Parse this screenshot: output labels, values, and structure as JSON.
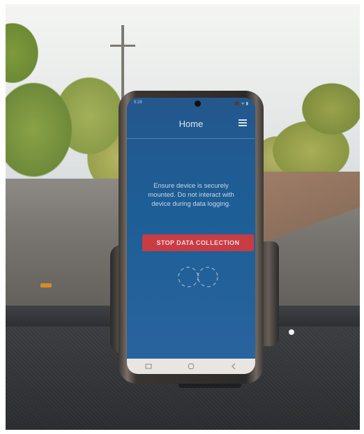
{
  "app": {
    "title": "Home",
    "status_time": "5:28",
    "status_right": "⬛ ᯤ ▮"
  },
  "screen": {
    "instructions": "Ensure device is securely mounted. Do not interact with device during data logging.",
    "stop_button_label": "STOP DATA COLLECTION"
  },
  "colors": {
    "screen_blue": "#1d5e96",
    "button_red": "#c83c44"
  },
  "icons": {
    "menu": "hamburger-menu-icon",
    "loading": "spinner-icon",
    "nav": [
      "recent-apps-icon",
      "home-icon",
      "back-icon"
    ]
  }
}
